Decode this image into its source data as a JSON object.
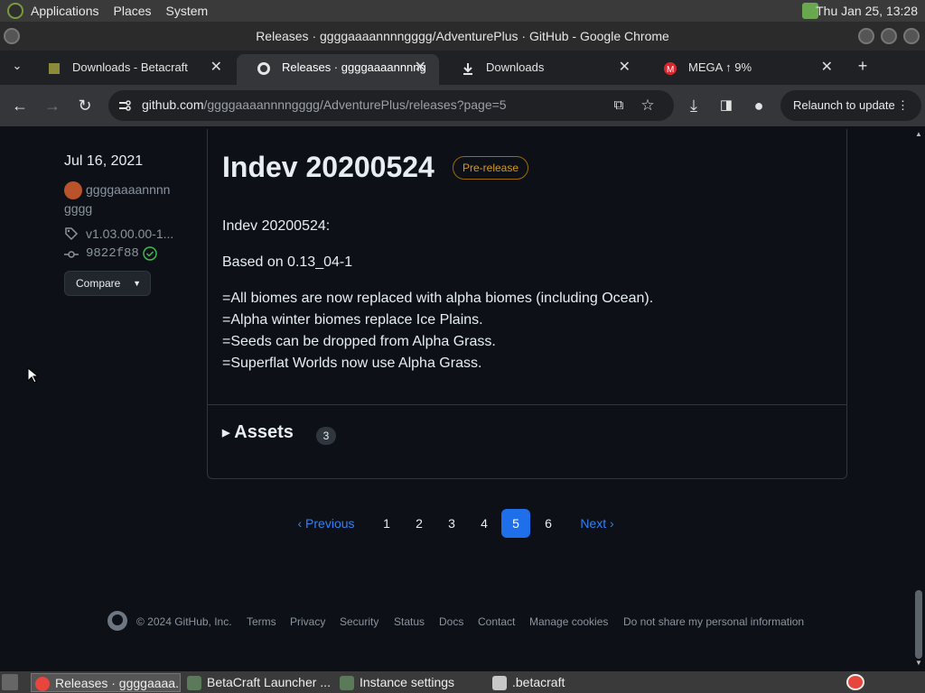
{
  "system_panel": {
    "menus": [
      "Applications",
      "Places",
      "System"
    ],
    "clock": "Thu Jan 25, 13:28"
  },
  "window": {
    "title": "Releases · ggggaaaannnngggg/AdventurePlus · GitHub - Google Chrome"
  },
  "tabs": [
    {
      "label": "Downloads - Betacraft",
      "icon": "betacraft-icon"
    },
    {
      "label": "Releases · ggggaaaannnng",
      "icon": "github-icon"
    },
    {
      "label": "Downloads",
      "icon": "download-icon"
    },
    {
      "label": "MEGA ↑ 9%",
      "icon": "mega-icon"
    }
  ],
  "address_bar": {
    "host": "github.com",
    "path": "/ggggaaaannnngggg/AdventurePlus/releases?page=5",
    "relaunch_label": "Relaunch to update"
  },
  "release": {
    "date": "Jul 16, 2021",
    "author_line1": "ggggaaaannnn",
    "author_line2": "gggg",
    "tag": "v1.03.00.00-1...",
    "commit": "9822f88",
    "compare_label": "Compare",
    "title": "Indev 20200524",
    "badge": "Pre-release",
    "body": [
      "Indev 20200524:",
      "Based on 0.13_04-1",
      "=All biomes are now replaced with alpha biomes (including Ocean).",
      "=Alpha winter biomes replace Ice Plains.",
      "=Seeds can be dropped from Alpha Grass.",
      "=Superflat Worlds now use Alpha Grass."
    ],
    "assets_label": "Assets",
    "assets_count": "3"
  },
  "pagination": {
    "previous": "Previous",
    "pages": [
      "1",
      "2",
      "3",
      "4",
      "5",
      "6"
    ],
    "current": "5",
    "next": "Next"
  },
  "footer": {
    "copyright": "© 2024 GitHub, Inc.",
    "links": [
      "Terms",
      "Privacy",
      "Security",
      "Status",
      "Docs",
      "Contact",
      "Manage cookies",
      "Do not share my personal information"
    ]
  },
  "taskbar": [
    {
      "label": "Releases · ggggaaaa...",
      "icon": "chrome-icon"
    },
    {
      "label": "BetaCraft Launcher ...",
      "icon": "java-icon"
    },
    {
      "label": "Instance settings",
      "icon": "java-icon"
    },
    {
      "label": ".betacraft",
      "icon": "folder-icon"
    }
  ],
  "colors": {
    "page_bg": "#0d1117",
    "accent": "#1f6feb",
    "link": "#2f81f7",
    "prerelease": "#d29922"
  }
}
